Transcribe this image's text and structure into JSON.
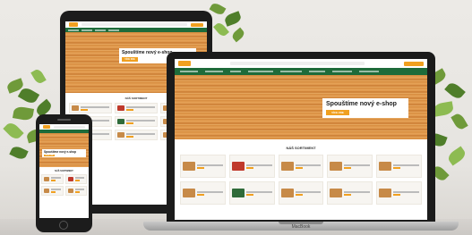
{
  "site": {
    "hero_title": "Spouštíme nový e-shop",
    "hero_button": "VÍCE ZDE",
    "section_title": "NÁŠ SORTIMENT"
  },
  "laptop": {
    "brand": "MacBook"
  },
  "colors": {
    "brand_green": "#1e6b3a",
    "accent_orange": "#f0a020",
    "wood": "#d58a3c"
  }
}
